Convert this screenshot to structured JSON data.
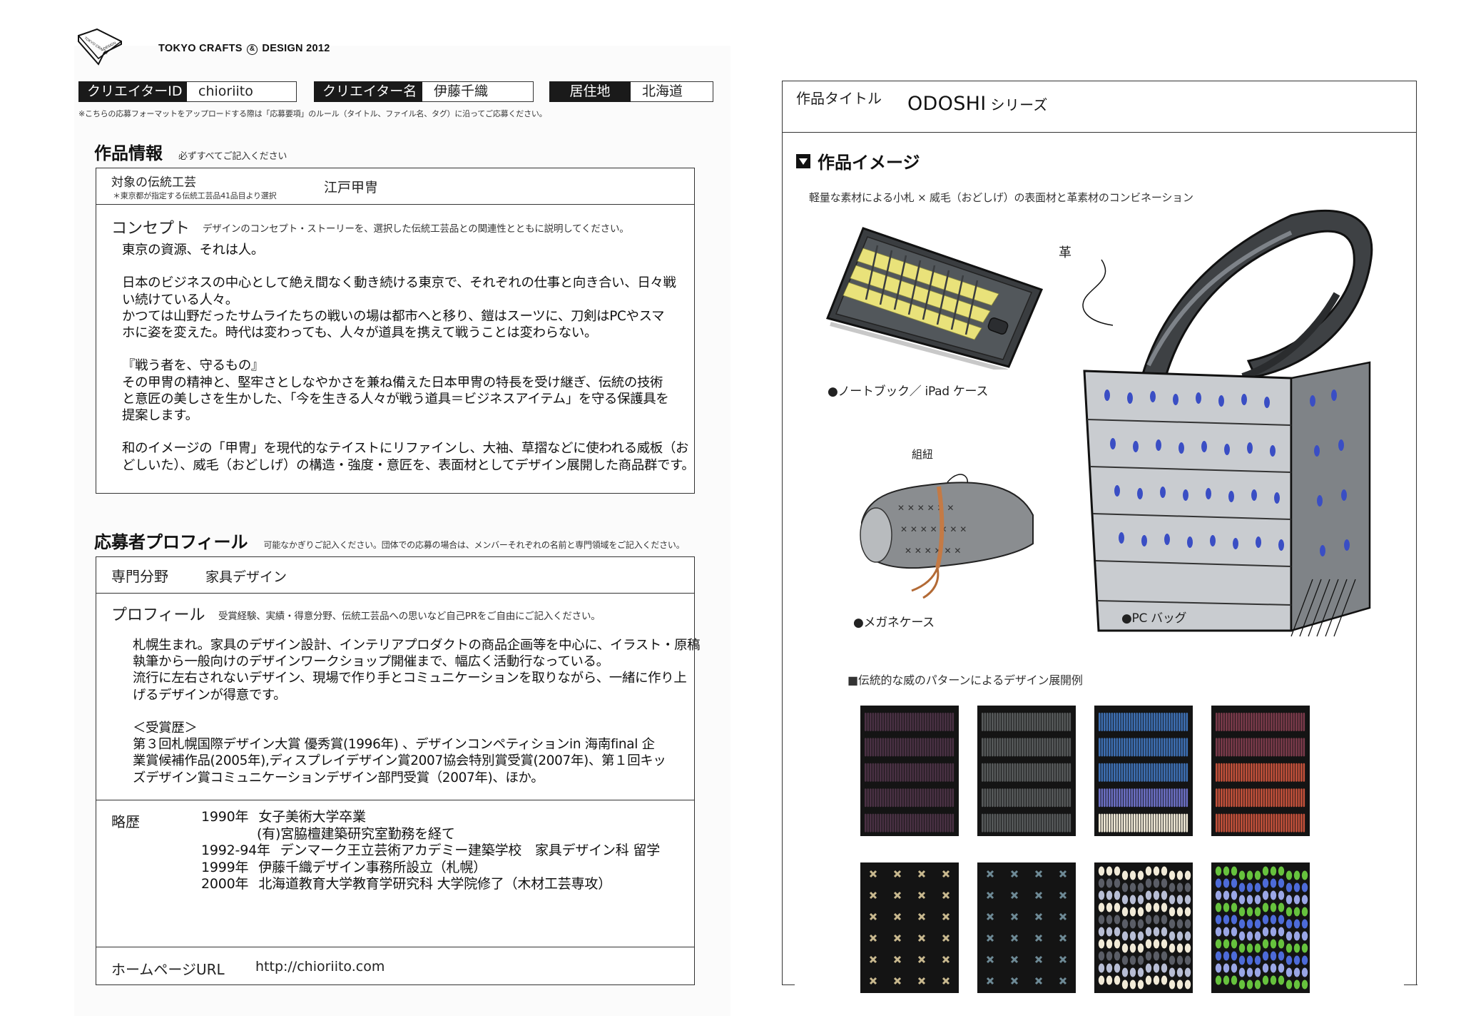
{
  "header": {
    "logo_text": "TOKYO CRAFTS & DESIGN 2012",
    "logo_prefix": "TOKYO CRAFTS",
    "logo_suffix": "DESIGN 2012",
    "logo_amp": "&",
    "logo_mark_text": [
      "TOKYO CRAFTS",
      "DESIGN"
    ]
  },
  "ids": [
    {
      "label": "クリエイターID",
      "value": "chioriito"
    },
    {
      "label": "クリエイター名",
      "value": "伊藤千織"
    },
    {
      "label": "居住地",
      "value": "北海道"
    }
  ],
  "note": "※こちらの応募フォーマットをアップロードする際は「応募要項」のルール（タイトル、ファイル名、タグ）に沿ってご応募ください。",
  "work_info": {
    "title": "作品情報",
    "subtitle": "必ずすべてご記入ください",
    "craft_label": "対象の伝統工芸",
    "craft_note": "＊東京都が指定する伝統工芸品41品目より選択",
    "craft_value": "江戸甲冑",
    "concept_label": "コンセプト",
    "concept_note": "デザインのコンセプト・ストーリーを、選択した伝統工芸品との関連性とともに説明してください。",
    "concept_lines": [
      "東京の資源、それは人。",
      "",
      "日本のビジネスの中心として絶え間なく動き続ける東京で、それぞれの仕事と向き合い、日々戦",
      "い続けている人々。",
      "かつては山野だったサムライたちの戦いの場は都市へと移り、鎧はスーツに、刀剣はPCやスマ",
      "ホに姿を変えた。時代は変わっても、人々が道具を携えて戦うことは変わらない。",
      "",
      "『戦う者を、守るもの』",
      "その甲冑の精神と、堅牢さとしなやかさを兼ね備えた日本甲冑の特長を受け継ぎ、伝統の技術",
      "と意匠の美しさを生かした、「今を生きる人々が戦う道具＝ビジネスアイテム」を守る保護具を",
      "提案します。",
      "",
      "和のイメージの「甲冑」を現代的なテイストにリファインし、大袖、草摺などに使われる威板（お",
      "どしいた）、威毛（おどしげ）の構造・強度・意匠を、表面材としてデザイン展開した商品群です。"
    ]
  },
  "profile": {
    "title": "応募者プロフィール",
    "subtitle": "可能なかぎりご記入ください。団体での応募の場合は、メンバーそれぞれの名前と専門領域をご記入ください。",
    "field_label": "専門分野",
    "field_value": "家具デザイン",
    "profile_label": "プロフィール",
    "profile_note": "受賞経験、実績・得意分野、伝統工芸品への思いなど自己PRをご自由にご記入ください。",
    "profile_lines": [
      "札幌生まれ。家具のデザイン設計、インテリアプロダクトの商品企画等を中心に、イラスト・原稿",
      "執筆から一般向けのデザインワークショップ開催まで、幅広く活動行なっている。",
      "流行に左右されないデザイン、現場で作り手とコミュニケーションを取りながら、一緒に作り上",
      "げるデザインが得意です。",
      "",
      "＜受賞歴＞",
      "第３回札幌国際デザイン大賞 優秀賞(1996年) 、デザインコンペティションin 海南final 企",
      "業賞候補作品(2005年),ディスプレイデザイン賞2007協会特別賞受賞(2007年)、第１回キッ",
      "ズデザイン賞コミュニケーションデザイン部門受賞（2007年)、ほか。"
    ],
    "history_label": "略歴",
    "history": [
      {
        "year": "1990年",
        "text": "女子美術大学卒業"
      },
      {
        "year": "",
        "text": "(有)宮脇檀建築研究室勤務を経て"
      },
      {
        "year": "1992-94年",
        "text": "デンマーク王立芸術アカデミー建築学校　家具デザイン科 留学"
      },
      {
        "year": "1999年",
        "text": "伊藤千織デザイン事務所設立（札幌）"
      },
      {
        "year": "2000年",
        "text": "北海道教育大学教育学研究科 大学院修了（木材工芸専攻）"
      }
    ],
    "url_label": "ホームページURL",
    "url_value": "http://chioriito.com"
  },
  "work": {
    "title_label": "作品タイトル",
    "title_value": "ODOSHI",
    "title_suffix": "シリーズ",
    "image_heading": "作品イメージ",
    "image_caption": "軽量な素材による小札 × 威毛（おどしげ）の表面材と革素材のコンビネーション",
    "items": [
      {
        "label": "●ノートブック／ iPad ケース"
      },
      {
        "label": "●メガネケース"
      },
      {
        "label": "●PC バッグ"
      }
    ],
    "notes": {
      "leather": "革",
      "cord": "組紐"
    },
    "pattern_heading": "■伝統的な威のパターンによるデザイン展開例"
  },
  "swatches": {
    "row1": [
      {
        "bands": [
          "#4a3144",
          "#4a3144",
          "#4a3144",
          "#4a3144",
          "#4a3144"
        ]
      },
      {
        "bands": [
          "#56595a",
          "#56595a",
          "#56595a",
          "#56595a",
          "#56595a"
        ]
      },
      {
        "bands": [
          "#3d6fb3",
          "#3d6fb3",
          "#3d6fb3",
          "#6b6fc4",
          "#f1ead7"
        ]
      },
      {
        "bands": [
          "#7a3a4a",
          "#7a3a4a",
          "#c2503a",
          "#c2503a",
          "#c2503a"
        ]
      }
    ],
    "row2": [
      {
        "type": "cross",
        "color": "#c9b98f"
      },
      {
        "type": "cross",
        "color": "#6e8a96"
      },
      {
        "type": "zigzag",
        "colors": [
          "#f1ead7",
          "#5a5d66",
          "#b7bdd4"
        ]
      },
      {
        "type": "zigzag",
        "colors": [
          "#66c23d",
          "#4d6bd8",
          "#9aa6e6"
        ]
      }
    ]
  }
}
